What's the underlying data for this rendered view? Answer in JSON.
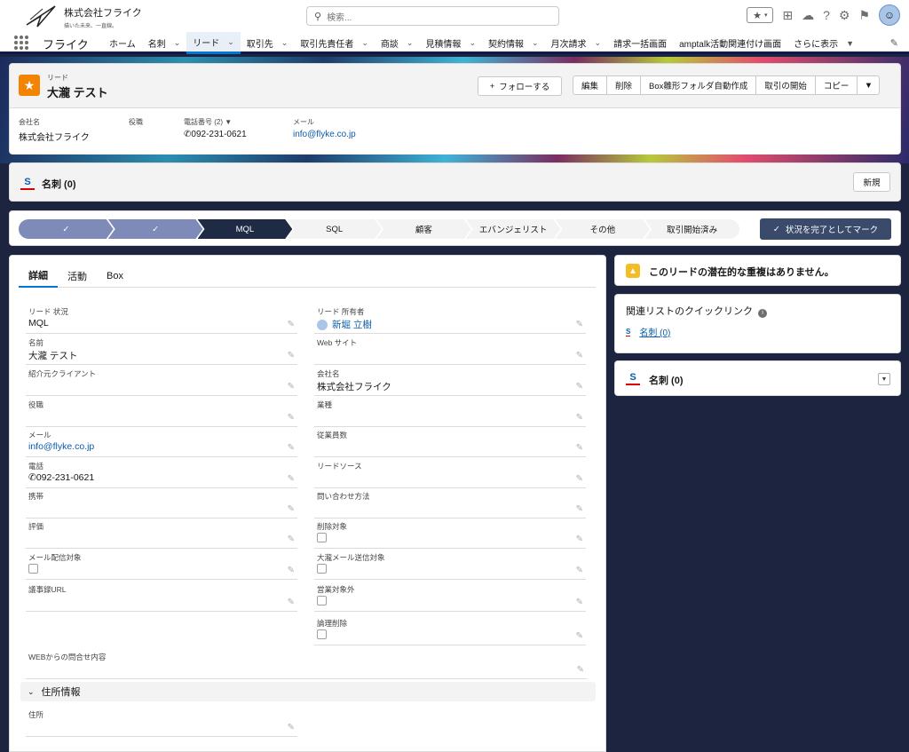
{
  "header": {
    "org_name": "株式会社フライク",
    "org_tagline": "描いた未来、一直線。",
    "search_placeholder": "検索..."
  },
  "nav": {
    "app_name": "フライク",
    "items": [
      {
        "label": "ホーム"
      },
      {
        "label": "名刺"
      },
      {
        "label": "リード"
      },
      {
        "label": "取引先"
      },
      {
        "label": "取引先責任者"
      },
      {
        "label": "商談"
      },
      {
        "label": "見積情報"
      },
      {
        "label": "契約情報"
      },
      {
        "label": "月次請求"
      },
      {
        "label": "請求一括画面"
      },
      {
        "label": "amptalk活動関連付け画面"
      },
      {
        "label": "さらに表示"
      }
    ]
  },
  "record": {
    "object_label": "リード",
    "title": "大瀧 テスト",
    "follow_label": "フォローする",
    "actions": [
      "編集",
      "削除",
      "Box雛形フォルダ自動作成",
      "取引の開始",
      "コピー"
    ],
    "highlights": [
      {
        "label": "会社名",
        "value": "株式会社フライク"
      },
      {
        "label": "役職",
        "value": ""
      },
      {
        "label": "電話番号 (2)",
        "value": "092-231-0621"
      },
      {
        "label": "メール",
        "value": "info@flyke.co.jp"
      }
    ]
  },
  "namecard_related": {
    "title": "名刺 (0)",
    "new_label": "新規"
  },
  "path": {
    "steps": [
      "",
      "",
      "MQL",
      "SQL",
      "顧客",
      "エバンジェリスト",
      "その他",
      "取引開始済み"
    ],
    "done_count": 2,
    "current_index": 2,
    "mark_complete_label": "状況を完了としてマーク"
  },
  "tabs": [
    "詳細",
    "活動",
    "Box"
  ],
  "fields_left": [
    {
      "label": "リード 状況",
      "value": "MQL"
    },
    {
      "label": "名前",
      "value": "大瀧 テスト"
    },
    {
      "label": "紹介元クライアント",
      "value": ""
    },
    {
      "label": "役職",
      "value": ""
    },
    {
      "label": "メール",
      "value": "info@flyke.co.jp"
    },
    {
      "label": "電話",
      "value": "092-231-0621"
    },
    {
      "label": "携帯",
      "value": ""
    },
    {
      "label": "評価",
      "value": ""
    },
    {
      "label": "メール配信対象",
      "value": ""
    },
    {
      "label": "議事録URL",
      "value": ""
    }
  ],
  "fields_right": [
    {
      "label": "リード 所有者",
      "value": "新堀 立樹"
    },
    {
      "label": "Web サイト",
      "value": ""
    },
    {
      "label": "会社名",
      "value": "株式会社フライク"
    },
    {
      "label": "業種",
      "value": ""
    },
    {
      "label": "従業員数",
      "value": ""
    },
    {
      "label": "リードソース",
      "value": ""
    },
    {
      "label": "問い合わせ方法",
      "value": ""
    },
    {
      "label": "削除対象",
      "value": ""
    },
    {
      "label": "大瀧メール送信対象",
      "value": ""
    },
    {
      "label": "営業対象外",
      "value": ""
    },
    {
      "label": "論理削除",
      "value": ""
    }
  ],
  "field_web_inquiry": {
    "label": "WEBからの問合せ内容",
    "value": ""
  },
  "address_section": {
    "title": "住所情報",
    "address_label": "住所",
    "address_value": ""
  },
  "duplicates": {
    "message": "このリードの潜在的な重複はありません。"
  },
  "quicklinks": {
    "title": "関連リストのクイックリンク",
    "link": "名刺 (0)"
  },
  "related_namecard": {
    "title": "名刺 (0)"
  },
  "icons": {
    "search": "search-icon",
    "favorite": "star-icon",
    "add": "plus-icon",
    "trailhead": "cloud-icon",
    "help": "question-icon",
    "setup": "gear-icon",
    "notifications": "bell-icon",
    "edit": "pencil-icon"
  }
}
